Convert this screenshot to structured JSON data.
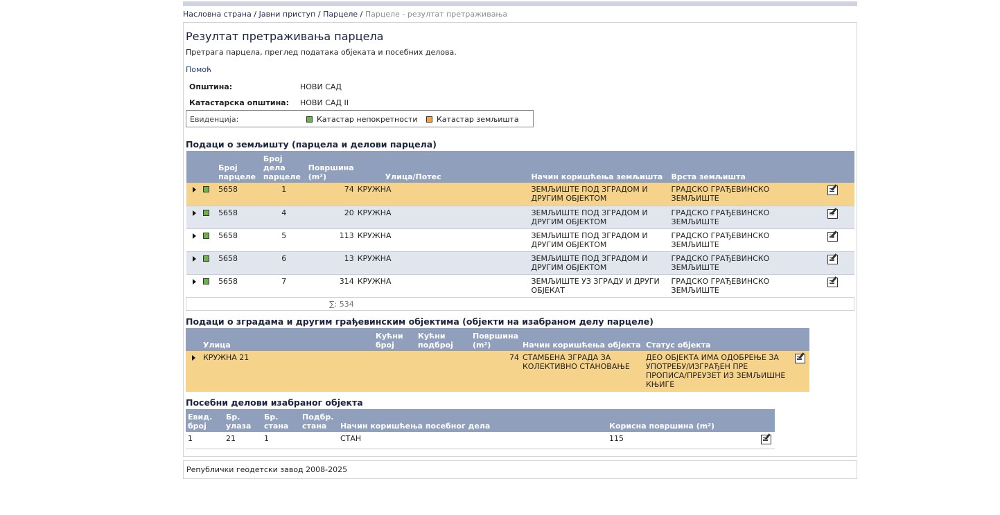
{
  "breadcrumb": {
    "home": "Насловна страна",
    "public": "Јавни приступ",
    "parcels": "Парцеле",
    "current": "Парцеле - резултат претраживања",
    "separator": "/"
  },
  "page": {
    "title": "Резултат претраживања парцела",
    "subtitle": "Претрага парцела, преглед података објеката и посебних делова.",
    "help_link": "Помоћ"
  },
  "info": {
    "municipality_label": "Општина:",
    "municipality_value": "НОВИ САД",
    "cadastral_label": "Катастарска општина:",
    "cadastral_value": "НОВИ САД II",
    "evidence_label": "Евиденција:",
    "legend_real_estate": "Катастар непокретности",
    "legend_land": "Катастар земљишта",
    "legend_colors": {
      "real_estate": "#6db34b",
      "land": "#f4a340"
    }
  },
  "land": {
    "heading": "Подаци о земљишту (парцела и делови парцела)",
    "columns": {
      "parcel_no": "Број парцеле",
      "part_no": "Број дела парцеле",
      "area": "Површина (m²)",
      "street": "Улица/Потес",
      "usage": "Начин коришћења земљишта",
      "land_type": "Врста земљишта"
    },
    "rows": [
      {
        "parcel_no": "5658",
        "part_no": "1",
        "area": "74",
        "street": "КРУЖНА",
        "usage": "ЗЕМЉИШТЕ ПОД ЗГРАДОМ И ДРУГИМ ОБЈЕКТОМ",
        "land_type": "ГРАДСКО ГРАЂЕВИНСКО ЗЕМЉИШТЕ"
      },
      {
        "parcel_no": "5658",
        "part_no": "4",
        "area": "20",
        "street": "КРУЖНА",
        "usage": "ЗЕМЉИШТЕ ПОД ЗГРАДОМ И ДРУГИМ ОБЈЕКТОМ",
        "land_type": "ГРАДСКО ГРАЂЕВИНСКО ЗЕМЉИШТЕ"
      },
      {
        "parcel_no": "5658",
        "part_no": "5",
        "area": "113",
        "street": "КРУЖНА",
        "usage": "ЗЕМЉИШТЕ ПОД ЗГРАДОМ И ДРУГИМ ОБЈЕКТОМ",
        "land_type": "ГРАДСКО ГРАЂЕВИНСКО ЗЕМЉИШТЕ"
      },
      {
        "parcel_no": "5658",
        "part_no": "6",
        "area": "13",
        "street": "КРУЖНА",
        "usage": "ЗЕМЉИШТЕ ПОД ЗГРАДОМ И ДРУГИМ ОБЈЕКТОМ",
        "land_type": "ГРАДСКО ГРАЂЕВИНСКО ЗЕМЉИШТЕ"
      },
      {
        "parcel_no": "5658",
        "part_no": "7",
        "area": "314",
        "street": "КРУЖНА",
        "usage": "ЗЕМЉИШТЕ УЗ ЗГРАДУ И ДРУГИ ОБЈЕКАТ",
        "land_type": "ГРАДСКО ГРАЂЕВИНСКО ЗЕМЉИШТЕ"
      }
    ],
    "total": "∑: 534"
  },
  "buildings": {
    "heading": "Подаци о зградама и другим грађевинским објектима (објекти на изабраном делу парцеле)",
    "columns": {
      "street": "Улица",
      "house_no": "Кућни број",
      "house_sub": "Кућни подброј",
      "area": "Површина (m²)",
      "usage": "Начин коришћења објекта",
      "status": "Статус објекта"
    },
    "rows": [
      {
        "street": "КРУЖНА 21",
        "house_no": "",
        "house_sub": "",
        "area": "74",
        "usage": "СТАМБЕНА ЗГРАДА ЗА КОЛЕКТИВНО СТАНОВАЊЕ",
        "status": "ДЕО ОБЈЕКТА ИМА ОДОБРЕЊЕ ЗА УПОТРЕБУ/ИЗГРАЂЕН ПРЕ ПРОПИСА/ПРЕУЗЕТ ИЗ ЗЕМЉИШНЕ КЊИГЕ"
      }
    ]
  },
  "parts": {
    "heading": "Посебни делови изабраног објекта",
    "columns": {
      "evid_no": "Евид. број",
      "entrance_no": "Бр. улаза",
      "apt_no": "Бр. стана",
      "apt_sub": "Подбр. стана",
      "usage": "Начин коришћења посебног дела",
      "useful_area": "Корисна површина (m²)"
    },
    "rows": [
      {
        "evid_no": "1",
        "entrance_no": "21",
        "apt_no": "1",
        "apt_sub": "",
        "usage": "СТАН",
        "useful_area": "115"
      }
    ]
  },
  "footer": {
    "text": "Републички геодетски завод 2008-2025"
  }
}
